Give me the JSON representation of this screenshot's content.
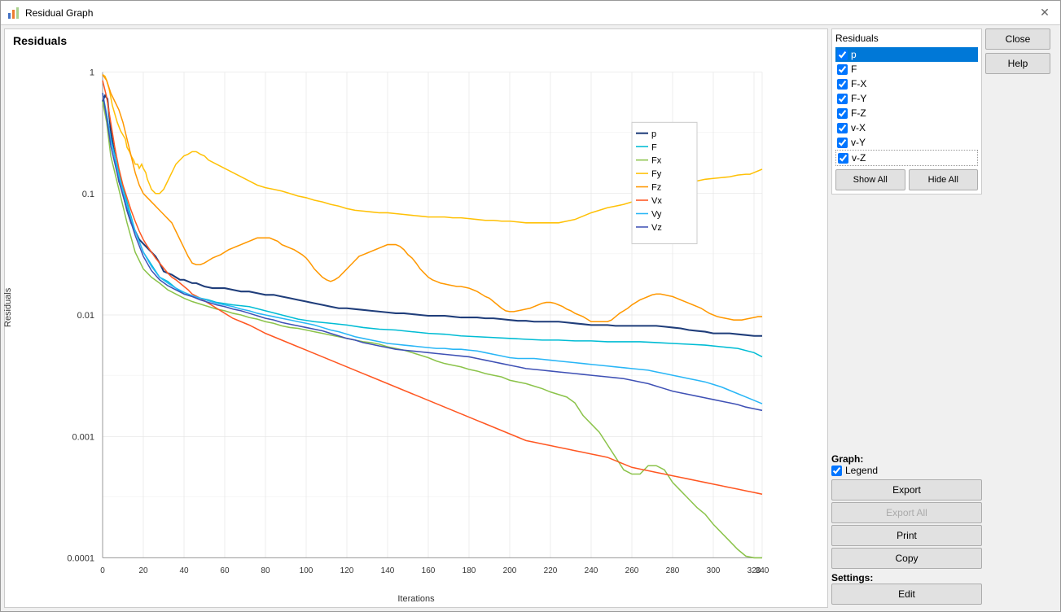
{
  "window": {
    "title": "Residual Graph",
    "icon": "chart-icon"
  },
  "chart": {
    "title": "Residuals",
    "y_label": "Residuals",
    "x_label": "Iterations",
    "y_ticks": [
      "1",
      "0.1",
      "0.01",
      "0.001",
      "0.0001"
    ],
    "x_ticks": [
      "0",
      "20",
      "40",
      "60",
      "80",
      "100",
      "120",
      "140",
      "160",
      "180",
      "200",
      "220",
      "240",
      "260",
      "280",
      "300",
      "320",
      "340"
    ],
    "legend": {
      "items": [
        {
          "label": "p",
          "color": "#1f3d7a"
        },
        {
          "label": "F",
          "color": "#00bcd4"
        },
        {
          "label": "Fx",
          "color": "#8bc34a"
        },
        {
          "label": "Fy",
          "color": "#ffc107"
        },
        {
          "label": "Fz",
          "color": "#ff9800"
        },
        {
          "label": "Vx",
          "color": "#ff5722"
        },
        {
          "label": "Vy",
          "color": "#29b6f6"
        },
        {
          "label": "Vz",
          "color": "#3f51b5"
        }
      ]
    }
  },
  "residuals_panel": {
    "title": "Residuals",
    "items": [
      {
        "label": "p",
        "checked": true,
        "selected": true
      },
      {
        "label": "F",
        "checked": true,
        "selected": false
      },
      {
        "label": "F-X",
        "checked": true,
        "selected": false
      },
      {
        "label": "F-Y",
        "checked": true,
        "selected": false
      },
      {
        "label": "F-Z",
        "checked": true,
        "selected": false
      },
      {
        "label": "v-X",
        "checked": true,
        "selected": false
      },
      {
        "label": "v-Y",
        "checked": true,
        "selected": false
      },
      {
        "label": "v-Z",
        "checked": true,
        "selected": false
      }
    ],
    "show_all": "Show All",
    "hide_all": "Hide All"
  },
  "graph_section": {
    "label": "Graph:",
    "legend_label": "Legend",
    "legend_checked": true
  },
  "buttons": {
    "close": "Close",
    "help": "Help",
    "export": "Export",
    "export_all": "Export All",
    "print": "Print",
    "copy": "Copy"
  },
  "settings": {
    "label": "Settings:",
    "edit": "Edit"
  }
}
